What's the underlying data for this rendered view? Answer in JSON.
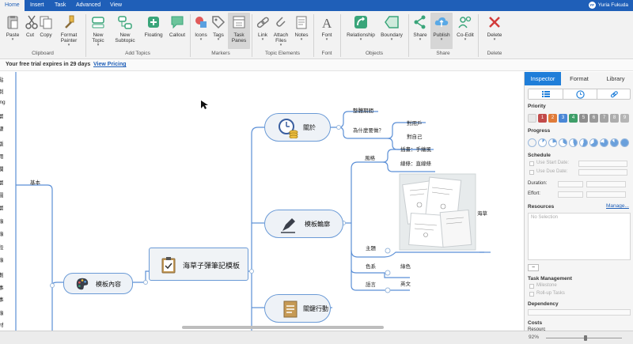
{
  "menu": {
    "tabs": [
      "Home",
      "Insert",
      "Task",
      "Advanced",
      "View"
    ],
    "active": "Home",
    "user": {
      "initials": "YF",
      "name": "Yuria Fukuda"
    }
  },
  "ribbon": {
    "buttons": [
      {
        "label": "Paste",
        "icon": "paste-icon",
        "dropdown": true
      },
      {
        "label": "Cut",
        "icon": "scissors-icon"
      },
      {
        "label": "Copy",
        "icon": "copy-icon"
      },
      {
        "label": "Format Painter",
        "icon": "brush-icon",
        "dropdown": true
      },
      {
        "label": "New Topic",
        "icon": "new-topic-icon",
        "dropdown": true
      },
      {
        "label": "New Subtopic",
        "icon": "new-subtopic-icon"
      },
      {
        "label": "Floating",
        "icon": "floating-topic-icon"
      },
      {
        "label": "Callout",
        "icon": "callout-icon"
      },
      {
        "label": "Icons",
        "icon": "icons-icon",
        "dropdown": true
      },
      {
        "label": "Tags",
        "icon": "tag-icon",
        "dropdown": true
      },
      {
        "label": "Task Panes",
        "icon": "task-panes-icon",
        "selected": true
      },
      {
        "label": "Link",
        "icon": "link-icon",
        "dropdown": true
      },
      {
        "label": "Attach Files",
        "icon": "paperclip-icon",
        "dropdown": true
      },
      {
        "label": "Notes",
        "icon": "notes-icon",
        "dropdown": true
      },
      {
        "label": "Font",
        "icon": "font-icon",
        "dropdown": true
      },
      {
        "label": "Relationship",
        "icon": "relationship-icon",
        "dropdown": true
      },
      {
        "label": "Boundary",
        "icon": "boundary-icon",
        "dropdown": true
      },
      {
        "label": "Share",
        "icon": "share-icon",
        "dropdown": true
      },
      {
        "label": "Publish",
        "icon": "cloud-publish-icon",
        "dropdown": true,
        "selected": true
      },
      {
        "label": "Co-Edit",
        "icon": "co-edit-icon",
        "dropdown": true
      },
      {
        "label": "Delete",
        "icon": "delete-x-icon",
        "dropdown": true
      }
    ],
    "groups": [
      "Clipboard",
      "Add Topics",
      "Markers",
      "Topic Elements",
      "Font",
      "Objects",
      "Share",
      "Delete"
    ]
  },
  "trial": {
    "message": "Your free trial expires in 29 days",
    "link": "View Pricing"
  },
  "mindmap": {
    "central": "海草子彈筆記模板",
    "topics": [
      {
        "label": "模板內容",
        "icon": "palette-icon"
      },
      {
        "label": "關於",
        "icon": "clock-coins-icon"
      },
      {
        "label": "模板輪廓",
        "icon": "pen-icon"
      },
      {
        "label": "關鍵行動",
        "icon": "document-icon"
      }
    ],
    "labels": {
      "basic": "基本",
      "overall": "整體期間",
      "why": "為什麼要做？",
      "for_users": "對用戶",
      "for_self": "對自己",
      "style": "風格",
      "illus": "插畫：手繪風",
      "lines": "線條：直線條",
      "seaweed": "海草",
      "theme": "主題",
      "color": "色系",
      "green": "綠色",
      "language": "語言",
      "english": "英文"
    },
    "left_fragments": [
      "點",
      "制",
      "ing",
      "層",
      "驟",
      "版",
      "用",
      "欄",
      "層",
      "園",
      "層",
      "錄",
      "錄",
      "段",
      "錄",
      "劃",
      "事",
      "事",
      "錄",
      "材"
    ]
  },
  "inspector": {
    "tabs": [
      "Inspector",
      "Format",
      "Library"
    ],
    "active": "Inspector",
    "subtabs": [
      "list-icon",
      "clock-icon",
      "link-icon"
    ],
    "priority": {
      "title": "Priority",
      "numbers": [
        "1",
        "2",
        "3",
        "4",
        "5",
        "6",
        "7",
        "8",
        "9"
      ],
      "colors": [
        "#c24a4a",
        "#e07b39",
        "#4a87d6",
        "#3e9e68",
        "#8e8e8e",
        "#9a9a9a",
        "#a4a4a4",
        "#adadad",
        "#b5b5b5"
      ]
    },
    "progress": {
      "title": "Progress"
    },
    "schedule": {
      "title": "Schedule",
      "start": "Use Start Date:",
      "due": "Use Due Date:",
      "duration": "Duration:",
      "effort": "Effort:"
    },
    "resources": {
      "title": "Resources",
      "manage": "Manage...",
      "placeholder": "No Selection"
    },
    "task_management": {
      "title": "Task Management",
      "milestone": "Milestone",
      "rollup": "Roll-up Tasks"
    },
    "dependency": {
      "title": "Dependency"
    },
    "costs": {
      "title": "Costs",
      "partial": "Resourc"
    }
  },
  "status": {
    "zoom": "92%"
  }
}
